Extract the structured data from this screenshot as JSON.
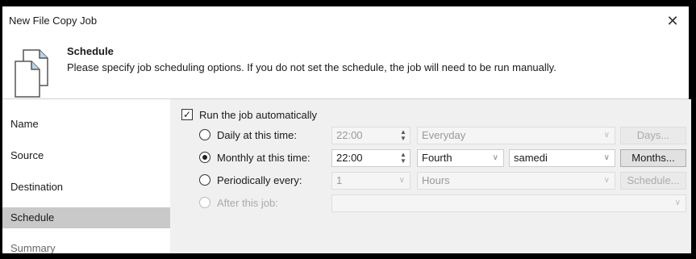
{
  "window": {
    "title": "New File Copy Job",
    "close_glyph": "✕"
  },
  "header": {
    "title": "Schedule",
    "description": "Please specify job scheduling options. If you do not set the schedule, the job will need to be run manually."
  },
  "sidebar": {
    "items": [
      {
        "label": "Name"
      },
      {
        "label": "Source"
      },
      {
        "label": "Destination"
      },
      {
        "label": "Schedule"
      },
      {
        "label": "Summary"
      }
    ]
  },
  "schedule": {
    "run_auto": {
      "label": "Run the job automatically",
      "checked": true
    },
    "daily": {
      "label": "Daily at this time:",
      "time": "22:00",
      "days": "Everyday",
      "button": "Days..."
    },
    "monthly": {
      "label": "Monthly at this time:",
      "time": "22:00",
      "week": "Fourth",
      "day": "samedi",
      "button": "Months..."
    },
    "periodic": {
      "label": "Periodically every:",
      "value": "1",
      "unit": "Hours",
      "button": "Schedule..."
    },
    "after": {
      "label": "After this job:",
      "value": ""
    }
  }
}
